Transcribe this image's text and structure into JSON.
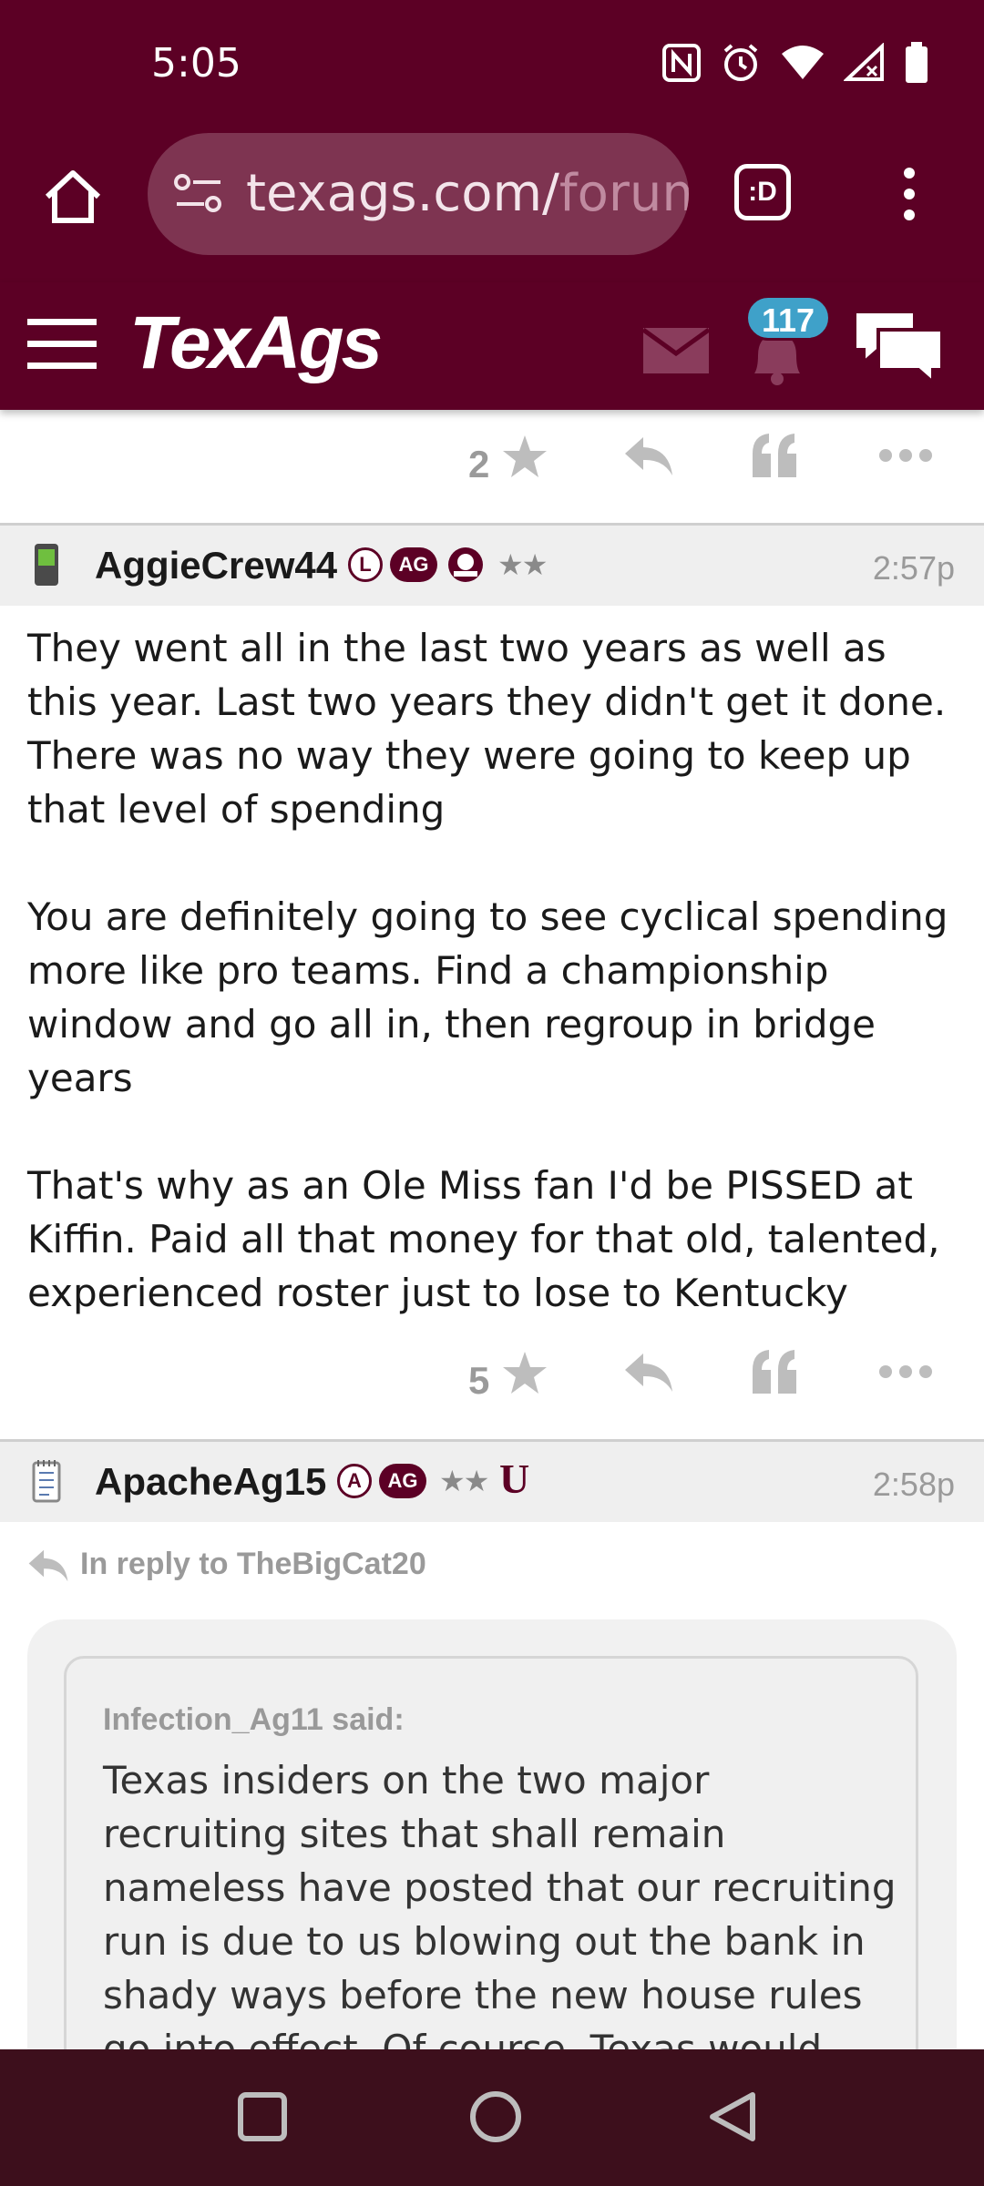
{
  "status_bar": {
    "time": "5:05"
  },
  "browser": {
    "url_main": "texags.com/",
    "url_rest": "forum",
    "tab_label": ":D"
  },
  "site": {
    "logo": "TexAgs",
    "notification_count": "117"
  },
  "posts": [
    {
      "stars": "2"
    },
    {
      "username": "AggieCrew44",
      "time": "2:57p",
      "badge_letter": "L",
      "badge_ag": "AG",
      "rank_stars": "★★",
      "stars": "5",
      "paragraphs": [
        "They went all in the last two years as well as this year. Last two years they didn't get it done. There was no way they were going to keep up that level of spending",
        "You are definitely going to see cyclical spending more like pro teams. Find a championship window and go all in, then regroup in bridge years",
        "That's why as an Ole Miss fan I'd be PISSED at Kiffin. Paid all that money for that old, talented, experienced roster just to lose to Kentucky"
      ]
    },
    {
      "username": "ApacheAg15",
      "time": "2:58p",
      "badge_letter": "A",
      "badge_ag": "AG",
      "rank_stars": "★★",
      "badge_u": "U",
      "in_reply_to": "In reply to TheBigCat20",
      "quote_author": "Infection_Ag11 said:",
      "quote_text": "Texas insiders on the two major recruiting sites that shall remain nameless have posted that our recruiting run is due to us blowing out the bank in shady ways before the new house rules go into effect. Of course, Texas would"
    }
  ],
  "colors": {
    "maroon": "#5c0025",
    "badge_blue": "#3fa1c9",
    "navbar": "#3d0f1c"
  }
}
